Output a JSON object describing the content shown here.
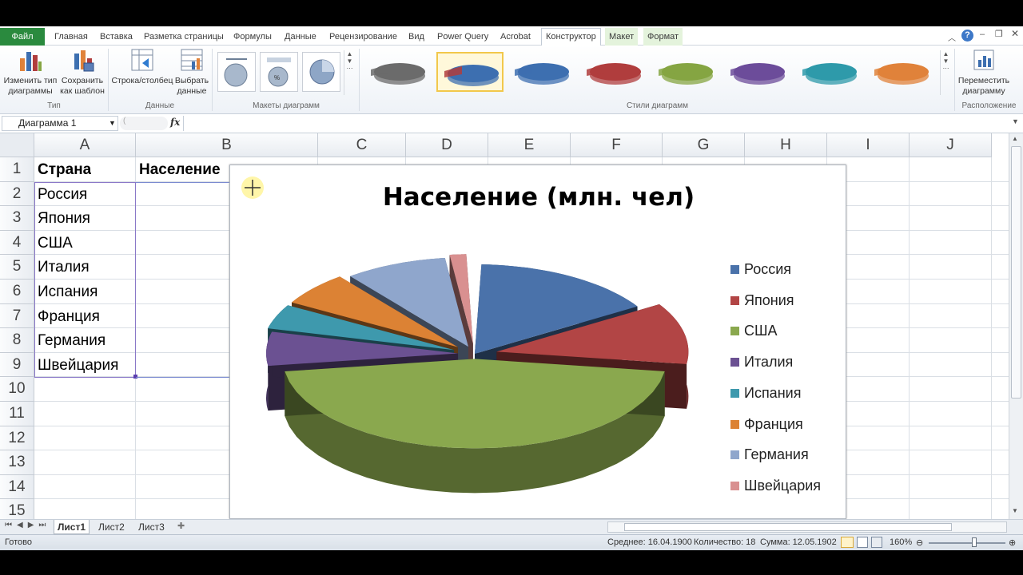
{
  "ribbon": {
    "tabs": [
      {
        "label": "Файл",
        "kind": "file"
      },
      {
        "label": "Главная"
      },
      {
        "label": "Вставка"
      },
      {
        "label": "Разметка страницы"
      },
      {
        "label": "Формулы"
      },
      {
        "label": "Данные"
      },
      {
        "label": "Рецензирование"
      },
      {
        "label": "Вид"
      },
      {
        "label": "Power Query"
      },
      {
        "label": "Acrobat"
      },
      {
        "label": "Конструктор",
        "kind": "active"
      },
      {
        "label": "Макет",
        "kind": "ctx"
      },
      {
        "label": "Формат",
        "kind": "ctx"
      }
    ],
    "groups": {
      "type": {
        "label": "Тип",
        "change_type_line1": "Изменить тип",
        "change_type_line2": "диаграммы",
        "save_template_line1": "Сохранить",
        "save_template_line2": "как шаблон"
      },
      "data": {
        "label": "Данные",
        "switch_row_col": "Строка/столбец",
        "select_data_line1": "Выбрать",
        "select_data_line2": "данные"
      },
      "layouts": {
        "label": "Макеты диаграмм"
      },
      "styles": {
        "label": "Стили диаграмм",
        "colors": [
          "#6b6b6b",
          "#3d6fb0",
          "#3d6fb0",
          "#b03d3d",
          "#85a542",
          "#6c4c9a",
          "#2e9aaa",
          "#e0823a"
        ]
      },
      "location": {
        "label": "Расположение",
        "move_chart_line1": "Переместить",
        "move_chart_line2": "диаграмму"
      }
    }
  },
  "formula_bar": {
    "name_box": "Диаграмма 1",
    "fx": "fx",
    "formula": ""
  },
  "sheet": {
    "columns": [
      "A",
      "B",
      "C",
      "D",
      "E",
      "F",
      "G",
      "H",
      "I",
      "J"
    ],
    "rows": [
      "1",
      "2",
      "3",
      "4",
      "5",
      "6",
      "7",
      "8",
      "9",
      "10",
      "11",
      "12",
      "13",
      "14",
      "15"
    ],
    "header_a": "Страна",
    "header_b": "Население",
    "countries": [
      "Россия",
      "Япония",
      "США",
      "Италия",
      "Испания",
      "Франция",
      "Германия",
      "Швейцария"
    ]
  },
  "chart_data": {
    "type": "pie",
    "title": "Население (млн. чел)",
    "categories": [
      "Россия",
      "Япония",
      "США",
      "Италия",
      "Испания",
      "Франция",
      "Германия",
      "Швейцария"
    ],
    "colors": [
      "#4a72aa",
      "#b24545",
      "#8aa84e",
      "#6b5192",
      "#3e99ad",
      "#dc8234",
      "#8fa6cc",
      "#d99090"
    ],
    "legend_position": "right",
    "exploded": true,
    "three_d": true
  },
  "sheet_tabs": [
    "Лист1",
    "Лист2",
    "Лист3"
  ],
  "status": {
    "ready": "Готово",
    "average": "Среднее: 16.04.1900",
    "count": "Количество: 18",
    "sum": "Сумма: 12.05.1902",
    "zoom": "160%"
  }
}
